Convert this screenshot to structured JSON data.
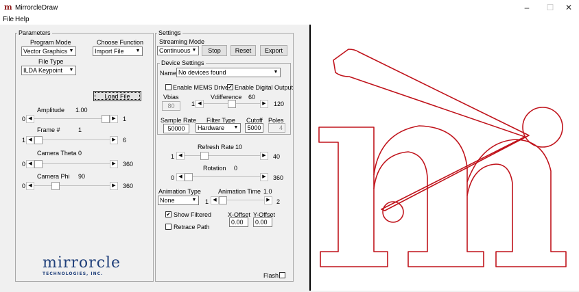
{
  "window": {
    "title": "MirrorcleDraw",
    "icon_glyph": "m",
    "minimize": "–",
    "maximize": "☐",
    "close": "✕"
  },
  "menu": [
    "File",
    "Help"
  ],
  "parameters": {
    "legend": "Parameters",
    "program_mode_label": "Program Mode",
    "program_mode_value": "Vector Graphics",
    "choose_function_label": "Choose Function",
    "choose_function_value": "Import File",
    "file_type_label": "File Type",
    "file_type_value": "ILDA Keypoint",
    "load_file": "Load File",
    "amplitude": {
      "label": "Amplitude",
      "value": "1.00",
      "min": "0",
      "max": "1",
      "fraction": 1.0
    },
    "frame": {
      "label": "Frame #",
      "value": "1",
      "min": "1",
      "max": "6",
      "fraction": 0.0
    },
    "camera_theta": {
      "label": "Camera Theta",
      "value": "0",
      "min": "0",
      "max": "360",
      "fraction": 0.0
    },
    "camera_phi": {
      "label": "Camera Phi",
      "value": "90",
      "min": "0",
      "max": "360",
      "fraction": 0.25
    },
    "logo_main": "mirrorcle",
    "logo_sub": "TECHNOLOGIES, INC."
  },
  "settings": {
    "legend": "Settings",
    "streaming_mode_label": "Streaming Mode",
    "streaming_mode_value": "Continuous",
    "stop": "Stop",
    "reset": "Reset",
    "export": "Export",
    "device_legend": "Device Settings",
    "name_label": "Name",
    "name_value": "No devices found",
    "enable_mems": "Enable MEMS Driver",
    "enable_mems_checked": false,
    "enable_digital": "Enable Digital Output",
    "enable_digital_checked": true,
    "vbias_label": "Vbias",
    "vbias_value": "80",
    "vdiff_label": "Vdifference",
    "vdiff_value": "60",
    "vdiff_min": "1",
    "vdiff_max": "120",
    "vdiff_fraction": 0.5,
    "sample_rate_label": "Sample Rate",
    "sample_rate_value": "50000",
    "filter_type_label": "Filter Type",
    "filter_type_value": "Hardware",
    "cutoff_label": "Cutoff",
    "cutoff_value": "5000",
    "poles_label": "Poles",
    "poles_value": "4",
    "refresh_rate": {
      "label": "Refresh Rate",
      "value": "10",
      "min": "1",
      "max": "40",
      "fraction": 0.23
    },
    "rotation": {
      "label": "Rotation",
      "value": "0",
      "min": "0",
      "max": "360",
      "fraction": 0.0
    },
    "animation_type_label": "Animation Type",
    "animation_type_value": "None",
    "animation_time_label": "Animation Time",
    "animation_time_value": "1.0",
    "animation_time_min": "1",
    "animation_time_max": "2",
    "animation_time_fraction": 0.0,
    "show_filtered": "Show Filtered",
    "show_filtered_checked": true,
    "retrace_path": "Retrace Path",
    "retrace_path_checked": false,
    "x_offset_label": "X-Offset",
    "x_offset_value": "0.00",
    "y_offset_label": "Y-Offset",
    "y_offset_value": "0.00",
    "flash_label": "Flash",
    "flash_checked": false
  },
  "canvas": {
    "stroke_color": "#c0141c",
    "background": "#ffffff"
  }
}
